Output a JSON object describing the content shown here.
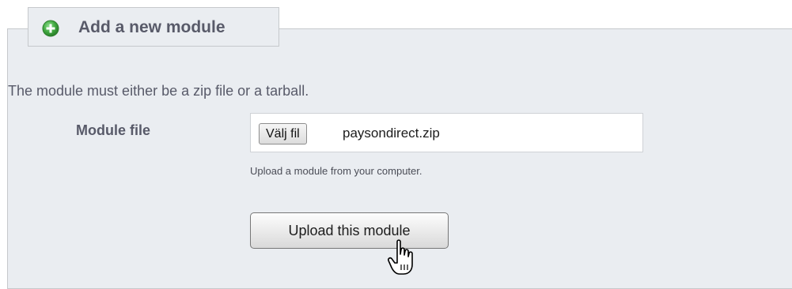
{
  "section": {
    "title": "Add a new module",
    "icon": "add-circle-icon",
    "description": "The module must either be a zip file or a tarball."
  },
  "form": {
    "field_label": "Module file",
    "choose_button_label": "Välj fil",
    "selected_file_name": "paysondirect.zip",
    "hint": "Upload a module from your computer.",
    "submit_label": "Upload this module"
  },
  "colors": {
    "panel_background": "#eaedf1",
    "panel_border": "#c6c9cc",
    "text": "#585a69",
    "icon_green": "#3fa73f"
  }
}
